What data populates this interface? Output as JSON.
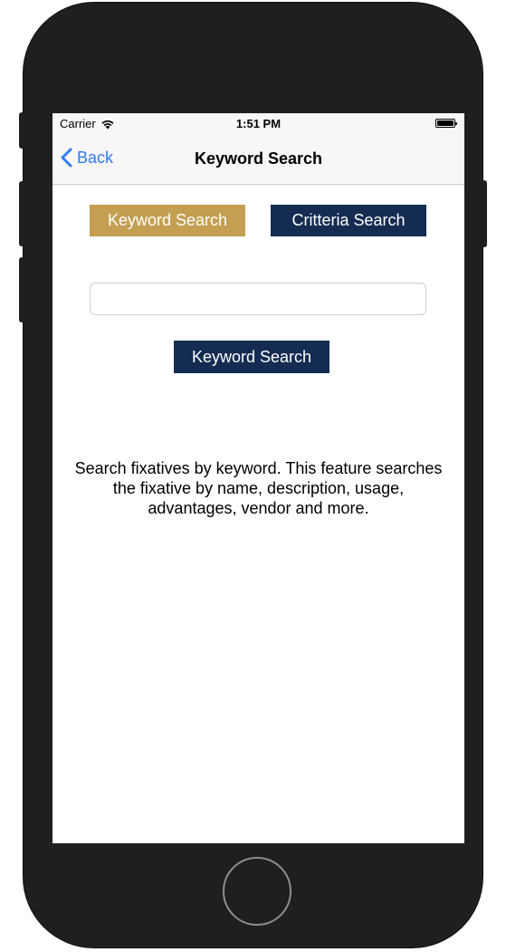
{
  "status_bar": {
    "carrier": "Carrier",
    "time": "1:51 PM",
    "wifi_icon": "wifi-icon",
    "battery_icon": "battery-full-icon"
  },
  "nav": {
    "back_label": "Back",
    "back_icon": "chevron-left-icon",
    "title": "Keyword Search",
    "accent_color": "#2f7cf6"
  },
  "tabs": [
    {
      "label": "Keyword Search",
      "active": true,
      "color": "#c49f52"
    },
    {
      "label": "Critteria Search",
      "active": false,
      "color": "#152c52"
    }
  ],
  "search": {
    "value": "",
    "placeholder": "",
    "button_label": "Keyword Search",
    "button_color": "#152c52"
  },
  "description": "Search fixatives by keyword. This feature searches the fixative by name, description, usage, advantages, vendor and more."
}
